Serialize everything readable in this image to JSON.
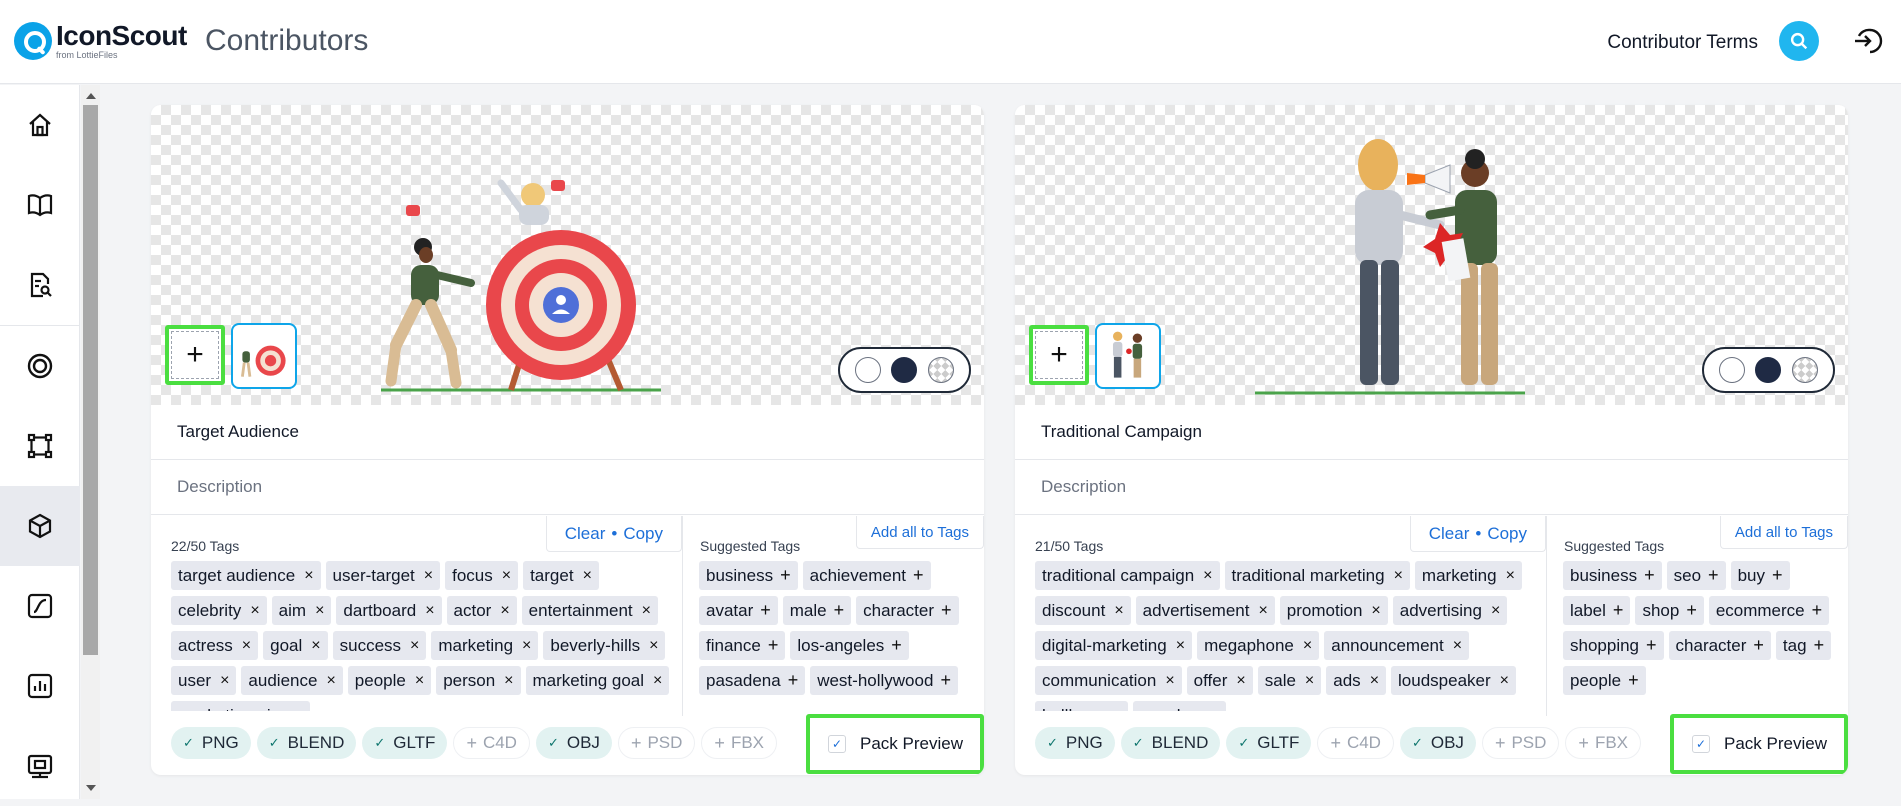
{
  "header": {
    "logo_name": "IconScout",
    "logo_sub": "from LottieFiles",
    "app_title": "Contributors",
    "terms_link": "Contributor Terms"
  },
  "colors": {
    "accent": "#1d6fd8",
    "brand": "#0aa2e8",
    "highlight": "#4ade40",
    "active_nav": "#e8eaef"
  },
  "sidebar": {
    "items": [
      {
        "icon": "home-icon"
      },
      {
        "icon": "book-icon"
      },
      {
        "icon": "document-search-icon"
      },
      {
        "icon": "target-icon"
      },
      {
        "icon": "vector-icon"
      },
      {
        "icon": "cube-icon",
        "active": true
      },
      {
        "icon": "animation-icon"
      },
      {
        "icon": "chart-icon"
      },
      {
        "icon": "store-icon"
      }
    ]
  },
  "cards": [
    {
      "title": "Target Audience",
      "description_placeholder": "Description",
      "tags_count": "22/50 Tags",
      "clear_label": "Clear",
      "sep": "•",
      "copy_label": "Copy",
      "suggested_title": "Suggested Tags",
      "add_all_label": "Add all to Tags",
      "tags": [
        "target audience",
        "user-target",
        "focus",
        "target",
        "celebrity",
        "aim",
        "dartboard",
        "actor",
        "entertainment",
        "actress",
        "goal",
        "success",
        "marketing",
        "beverly-hills",
        "user",
        "audience",
        "people",
        "person",
        "marketing goal",
        "marketing aim"
      ],
      "suggested": [
        "business",
        "achievement",
        "avatar",
        "male",
        "character",
        "finance",
        "los-angeles",
        "pasadena",
        "west-hollywood"
      ],
      "formats": [
        {
          "label": "PNG",
          "on": true
        },
        {
          "label": "BLEND",
          "on": true
        },
        {
          "label": "GLTF",
          "on": true
        },
        {
          "label": "C4D",
          "on": false
        },
        {
          "label": "OBJ",
          "on": true
        },
        {
          "label": "PSD",
          "on": false
        },
        {
          "label": "FBX",
          "on": false
        }
      ],
      "pack_preview": "Pack Preview"
    },
    {
      "title": "Traditional Campaign",
      "description_placeholder": "Description",
      "tags_count": "21/50 Tags",
      "clear_label": "Clear",
      "sep": "•",
      "copy_label": "Copy",
      "suggested_title": "Suggested Tags",
      "add_all_label": "Add all to Tags",
      "tags": [
        "traditional campaign",
        "traditional marketing",
        "marketing",
        "discount",
        "advertisement",
        "promotion",
        "advertising",
        "digital-marketing",
        "megaphone",
        "announcement",
        "communication",
        "offer",
        "sale",
        "ads",
        "loudspeaker",
        "bullhorn",
        "speaker"
      ],
      "suggested": [
        "business",
        "seo",
        "buy",
        "label",
        "shop",
        "ecommerce",
        "shopping",
        "character",
        "tag",
        "people"
      ],
      "formats": [
        {
          "label": "PNG",
          "on": true
        },
        {
          "label": "BLEND",
          "on": true
        },
        {
          "label": "GLTF",
          "on": true
        },
        {
          "label": "C4D",
          "on": false
        },
        {
          "label": "OBJ",
          "on": true
        },
        {
          "label": "PSD",
          "on": false
        },
        {
          "label": "FBX",
          "on": false
        }
      ],
      "pack_preview": "Pack Preview"
    }
  ],
  "glyphs": {
    "remove": "×",
    "add": "+",
    "check": "✓",
    "plus_big": "+"
  }
}
